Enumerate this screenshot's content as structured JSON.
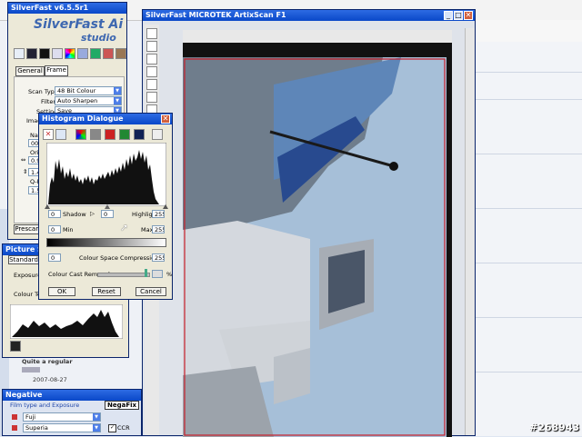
{
  "silverfast": {
    "title": "SilverFast v6.5.5r1",
    "brand_line1": "SilverFast Ai",
    "brand_line2": "studio",
    "tabs": [
      "General",
      "Frame"
    ],
    "scan_type_label": "Scan Type:",
    "scan_type_value": "48 Bit Colour",
    "filter_label": "Filter:",
    "filter_value": "Auto Sharpen",
    "setting_label": "Setting:",
    "setting_value": "Save",
    "image_label": "Image",
    "name_label": "Nam",
    "name_value": "001",
    "orig_label": "Origi",
    "val1": "0.9",
    "val2": "1.4",
    "qf_label": "Q-F",
    "val3": "1.5",
    "prescan_label": "Prescan"
  },
  "histogram": {
    "title": "Histogram Dialogue",
    "shadow_value": "0",
    "shadow_label": "Shadow",
    "midtone_value": "0",
    "highlight_label": "Highlight",
    "highlight_value": "255",
    "min_value": "0",
    "min_label": "Min",
    "max_label": "Max",
    "max_value": "255",
    "ccc_value_left": "0",
    "ccc_label": "Colour Space Compression",
    "ccc_value_right": "255",
    "cast_label": "Colour Cast Removal",
    "cast_unit": "%",
    "ok_label": "OK",
    "reset_label": "Reset",
    "cancel_label": "Cancel"
  },
  "picture_settings": {
    "title": "Picture Setting",
    "tab_standard": "Standard",
    "exposure_label": "Exposure",
    "colour_temp_label": "Colour Tem"
  },
  "negative": {
    "title": "Negative",
    "section_label": "Film type and Exposure",
    "logo": "NegaFix",
    "film_brand": "Fuji",
    "film_type": "Superia",
    "ccr_label": "CCR"
  },
  "scan_window": {
    "title": "SilverFast MICROTEK ArtixScan F1"
  },
  "background": {
    "forum_text": "Quite a regular",
    "forum_date": "2007-08-27"
  },
  "watermark": "#268943",
  "colors": {
    "titlebar": "#0a48c8",
    "window_bg": "#ece9d8",
    "sky": "#a9c3dd",
    "frame_red": "#c81e2a"
  }
}
